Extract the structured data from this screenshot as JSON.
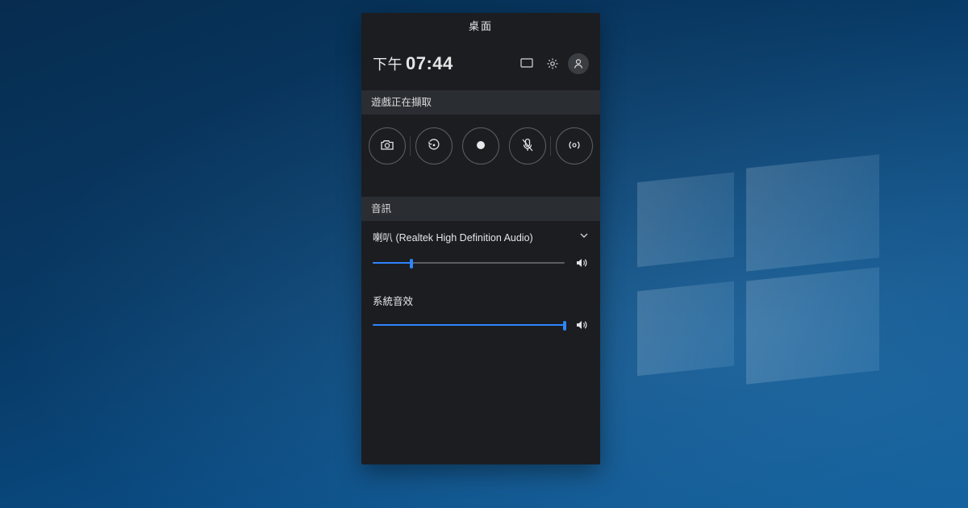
{
  "panel": {
    "title": "桌面",
    "clock_ampm": "下午",
    "clock_time": "07:44"
  },
  "icons": {
    "monitor": "monitor-icon",
    "settings": "gear-icon",
    "avatar": "person-icon"
  },
  "capture": {
    "heading": "遊戲正在擷取",
    "buttons": {
      "screenshot": "camera-icon",
      "last30": "replay-icon",
      "record": "record-icon",
      "mic": "mic-off-icon",
      "broadcast": "broadcast-icon"
    }
  },
  "audio": {
    "heading": "音訊",
    "device_label": "喇叭 (Realtek High Definition Audio)",
    "device_volume_pct": 20,
    "system_label": "系統音效",
    "system_volume_pct": 100
  },
  "colors": {
    "accent": "#2f84ff",
    "panel_bg": "#1b1d21",
    "section_bg": "#2a2d32"
  }
}
